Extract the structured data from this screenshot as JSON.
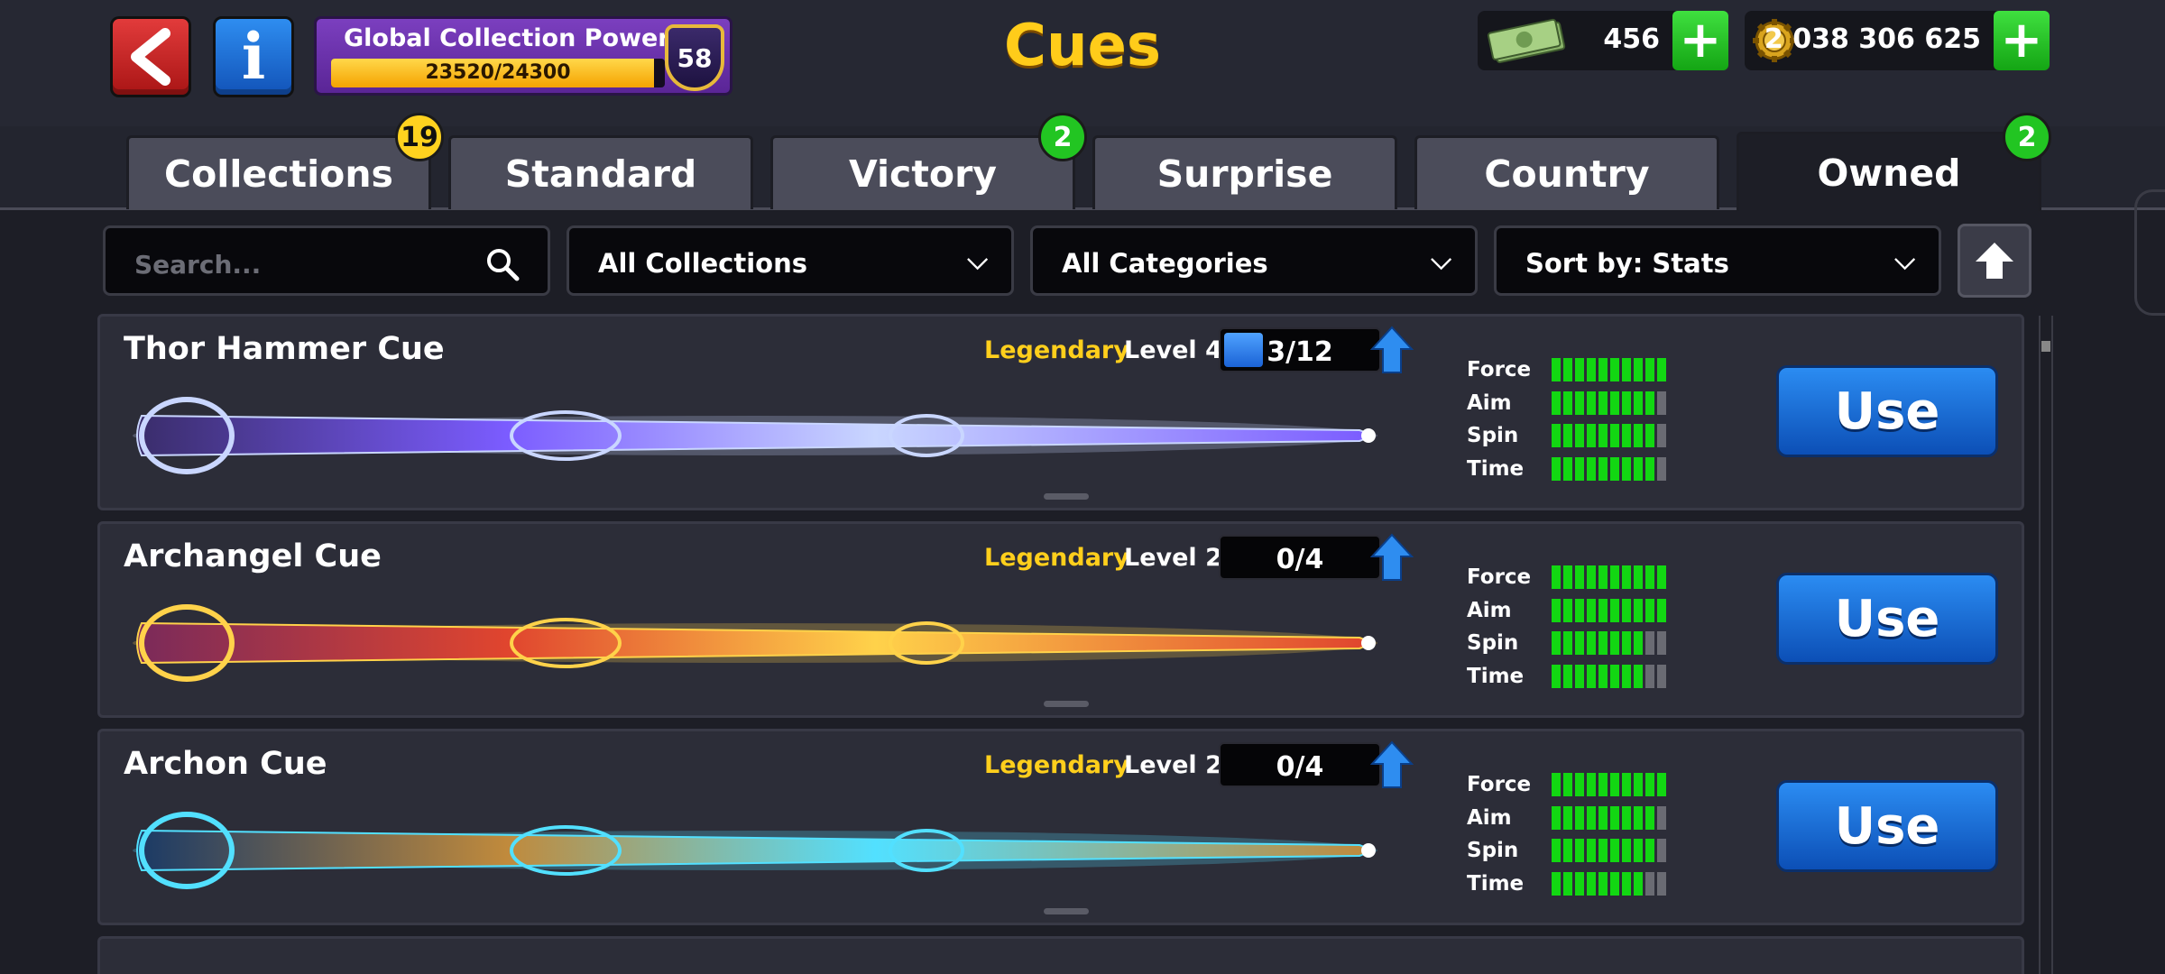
{
  "header": {
    "title": "Cues",
    "collection_power": {
      "label": "Global Collection Power",
      "progress_text": "23520/24300",
      "progress": 0.968,
      "level": "58"
    },
    "cash": {
      "value": "456"
    },
    "coins": {
      "value": "2 038 306 625"
    },
    "plus_label": "+"
  },
  "tabs": [
    {
      "label": "Collections",
      "badge": "19",
      "badge_color": "#ffd21f"
    },
    {
      "label": "Standard"
    },
    {
      "label": "Victory",
      "badge": "2",
      "badge_color": "#22c522"
    },
    {
      "label": "Surprise"
    },
    {
      "label": "Country"
    },
    {
      "label": "Owned",
      "badge": "2",
      "badge_color": "#22c522",
      "active": true
    }
  ],
  "filters": {
    "search_placeholder": "Search...",
    "collection": "All Collections",
    "category": "All Categories",
    "sort": "Sort by: Stats"
  },
  "cues": [
    {
      "name": "Thor Hammer Cue",
      "rarity": "Legendary",
      "level": "Level 4",
      "progress_text": "3/12",
      "progress": 0.25,
      "stats": {
        "Force": 10,
        "Aim": 9,
        "Spin": 9,
        "Time": 9
      },
      "use_label": "Use",
      "palette": [
        "#c9d6ff",
        "#7b5cff",
        "#3a2d6b"
      ]
    },
    {
      "name": "Archangel Cue",
      "rarity": "Legendary",
      "level": "Level 2",
      "progress_text": "0/4",
      "progress": 0,
      "stats": {
        "Force": 10,
        "Aim": 10,
        "Spin": 8,
        "Time": 8
      },
      "use_label": "Use",
      "palette": [
        "#ffd24a",
        "#e0452e",
        "#7a2a5a"
      ]
    },
    {
      "name": "Archon Cue",
      "rarity": "Legendary",
      "level": "Level 2",
      "progress_text": "0/4",
      "progress": 0,
      "stats": {
        "Force": 10,
        "Aim": 9,
        "Spin": 9,
        "Time": 8
      },
      "use_label": "Use",
      "palette": [
        "#52e0ff",
        "#c08a3c",
        "#1a3a66"
      ]
    }
  ],
  "stat_labels": [
    "Force",
    "Aim",
    "Spin",
    "Time"
  ],
  "stat_max": 10,
  "colors": {
    "accent_gold": "#ffcc1a",
    "legendary": "#ffcf1c",
    "stat_green": "#12d712",
    "use_blue": "#1b6fe0"
  }
}
